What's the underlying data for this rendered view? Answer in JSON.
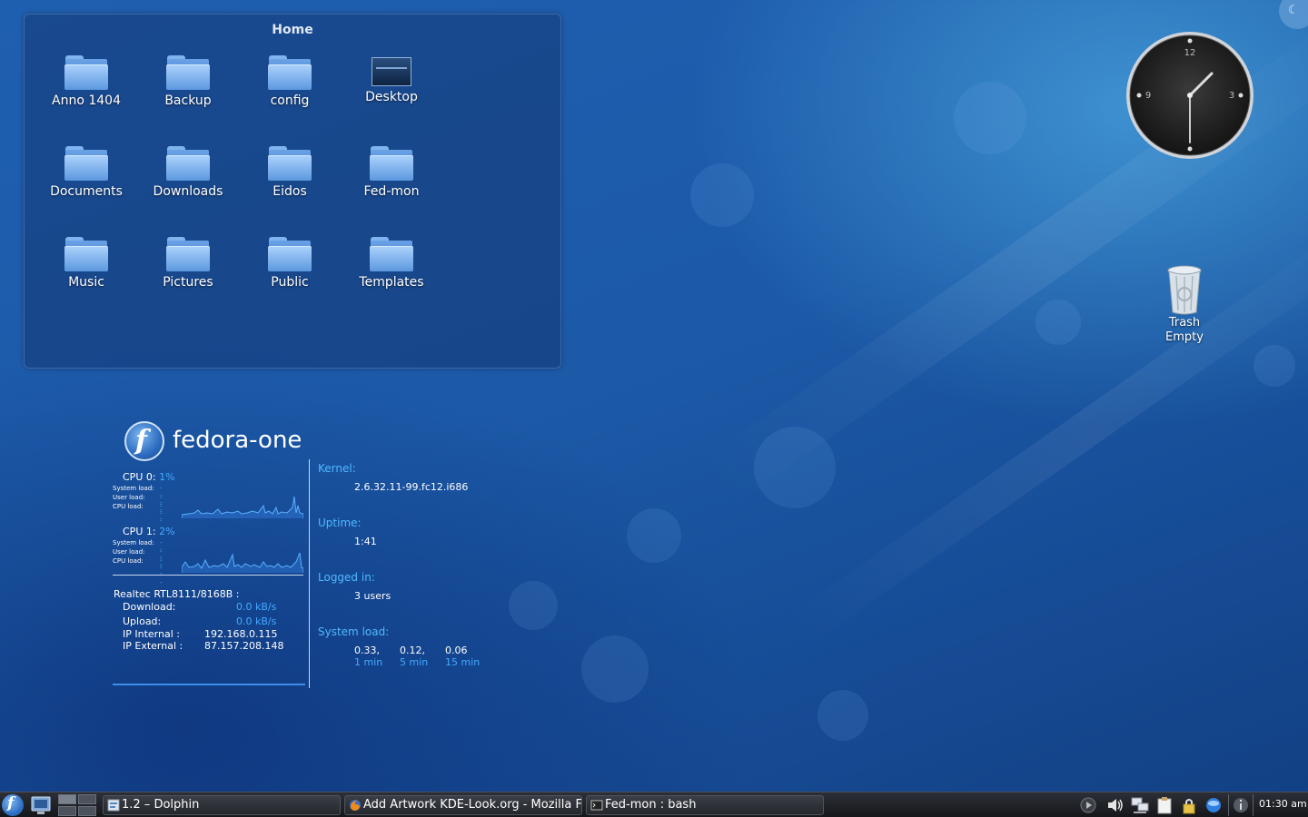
{
  "folderview": {
    "title": "Home",
    "items": [
      {
        "label": "Anno 1404",
        "type": "folder"
      },
      {
        "label": "Backup",
        "type": "folder"
      },
      {
        "label": "config",
        "type": "folder"
      },
      {
        "label": "Desktop",
        "type": "desktop"
      },
      {
        "label": "Documents",
        "type": "folder"
      },
      {
        "label": "Downloads",
        "type": "folder"
      },
      {
        "label": "Eidos",
        "type": "folder"
      },
      {
        "label": "Fed-mon",
        "type": "folder"
      },
      {
        "label": "Music",
        "type": "folder"
      },
      {
        "label": "Pictures",
        "type": "folder"
      },
      {
        "label": "Public",
        "type": "folder"
      },
      {
        "label": "Templates",
        "type": "folder"
      }
    ]
  },
  "clock": {
    "numerals": {
      "n12": "12",
      "n3": "3",
      "n9": "9"
    },
    "time_shown": "01:30"
  },
  "trash": {
    "line1": "Trash",
    "line2": "Empty"
  },
  "sysmon": {
    "hostname": "fedora-one",
    "cpus": [
      {
        "label": "CPU 0:",
        "percent": "1%",
        "system_label": "System load:",
        "user_label": "User load:",
        "cpu_label": "CPU load:",
        "system_val": "----",
        "user_val": "----",
        "cpu_val": "----"
      },
      {
        "label": "CPU 1:",
        "percent": "2%",
        "system_label": "System load:",
        "user_label": "User load:",
        "cpu_label": "CPU load:",
        "system_val": "----",
        "user_val": "----",
        "cpu_val": "----"
      }
    ],
    "network": {
      "adapter": "Realtec RTL8111/8168B :",
      "download_label": "Download:",
      "download_val": "0.0 kB/s",
      "upload_label": "Upload:",
      "upload_val": "0.0 kB/s",
      "ip_internal_label": "IP Internal :",
      "ip_internal_val": "192.168.0.115",
      "ip_external_label": "IP External :",
      "ip_external_val": "87.157.208.148"
    },
    "info": {
      "kernel_label": "Kernel:",
      "kernel_val": "2.6.32.11-99.fc12.i686",
      "uptime_label": "Uptime:",
      "uptime_val": "1:41",
      "logged_label": "Logged in:",
      "logged_val": "3 users",
      "load_label": "System load:",
      "load": [
        {
          "value": "0.33,",
          "period": "1 min"
        },
        {
          "value": "0.12,",
          "period": "5 min"
        },
        {
          "value": "0.06",
          "period": "15 min"
        }
      ]
    }
  },
  "taskbar": {
    "tasks": [
      {
        "label": "1.2 – Dolphin",
        "icon": "dolphin-icon"
      },
      {
        "label": "Add Artwork KDE-Look.org - Mozilla Fir",
        "icon": "firefox-icon"
      },
      {
        "label": "Fed-mon : bash",
        "icon": "terminal-icon"
      }
    ],
    "clock": "01:30 am"
  },
  "colors": {
    "accent": "#44aaff",
    "label_blue": "#4fb8ff",
    "background": "#1c5aa8"
  }
}
